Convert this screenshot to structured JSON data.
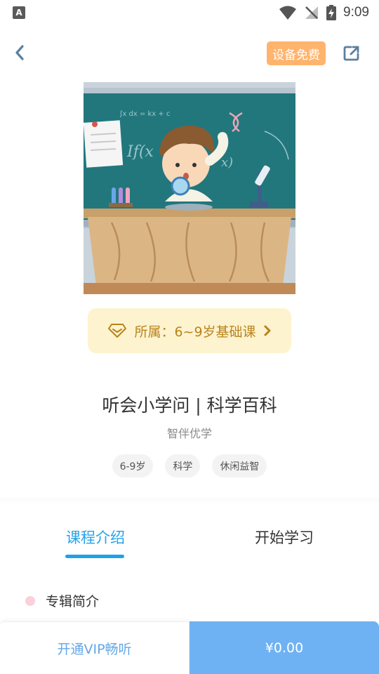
{
  "status_bar": {
    "time": "9:09",
    "app_icon_letter": "A",
    "icons": [
      "wifi-icon",
      "no-signal-icon",
      "battery-charging-icon"
    ]
  },
  "header": {
    "back_icon": "chevron-left-icon",
    "free_badge": "设备免费",
    "share_icon": "share-icon"
  },
  "cover": {
    "board_formula": "ʃx dx = kx + c",
    "board_formula2": "If(x",
    "board_formula3": "x)"
  },
  "category": {
    "icon": "diamond-icon",
    "label": "所属：6~9岁基础课",
    "arrow_icon": "chevron-right-icon"
  },
  "album": {
    "title": "听会小学问 | 科学百科",
    "publisher": "智伴优学",
    "tags": [
      "6-9岁",
      "科学",
      "休闲益智"
    ]
  },
  "tabs": [
    {
      "label": "课程介绍",
      "active": true
    },
    {
      "label": "开始学习",
      "active": false
    }
  ],
  "section": {
    "title": "专辑简介"
  },
  "bottom": {
    "vip_label": "开通VIP畅听",
    "price_label": "¥0.00"
  },
  "colors": {
    "accent_blue": "#25a3ea",
    "price_button": "#6fb2f3",
    "free_badge": "#ffb46e",
    "category_bg": "#fdf3cf",
    "category_text": "#b9831b"
  }
}
